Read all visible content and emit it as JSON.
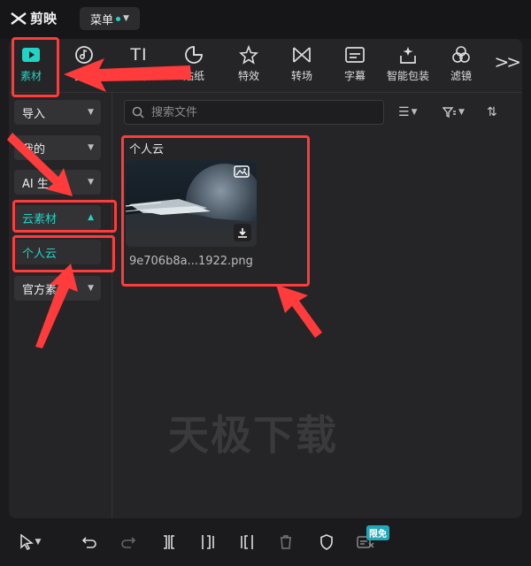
{
  "app": {
    "name": "剪映",
    "menu_label": "菜单"
  },
  "toolbar": {
    "items": [
      {
        "label": "素材",
        "icon": "play-box-icon"
      },
      {
        "label": "音频",
        "icon": "music-disc-icon"
      },
      {
        "label": "文本",
        "icon": "text-ti-icon"
      },
      {
        "label": "贴纸",
        "icon": "sticker-icon"
      },
      {
        "label": "特效",
        "icon": "effect-star-icon"
      },
      {
        "label": "转场",
        "icon": "transition-bowtie-icon"
      },
      {
        "label": "字幕",
        "icon": "subtitle-icon"
      },
      {
        "label": "智能包装",
        "icon": "smart-pack-icon"
      },
      {
        "label": "滤镜",
        "icon": "filter-circles-icon"
      }
    ],
    "more_label": ">>"
  },
  "sidebar": {
    "items": [
      {
        "label": "导入"
      },
      {
        "label": "我的"
      },
      {
        "label": "AI 生"
      },
      {
        "label": "云素材"
      },
      {
        "label": "个人云"
      },
      {
        "label": "官方素"
      }
    ]
  },
  "search": {
    "placeholder": "搜索文件"
  },
  "content": {
    "section_title": "个人云",
    "file_name": "9e706b8a...1922.png"
  },
  "watermark": "天极下载",
  "bottom": {
    "limit_badge": "限免"
  },
  "colors": {
    "accent": "#22d3c5",
    "annotation": "#ff3b3b"
  }
}
